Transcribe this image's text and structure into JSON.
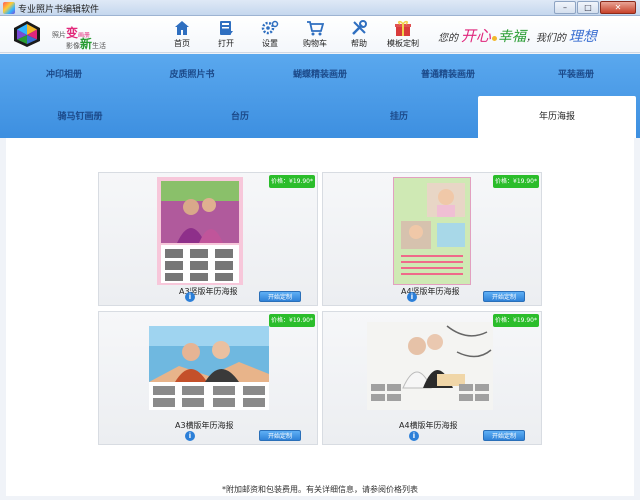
{
  "window": {
    "title": "专业照片书编辑软件"
  },
  "branding": {
    "slogan_left_part1": "照片",
    "slogan_left_big1": "变",
    "slogan_left_small1": "画册",
    "slogan_left_part2": "影像",
    "slogan_left_big2": "新",
    "slogan_left_part3": "生活",
    "slogan_right": [
      "您的",
      "开心",
      "幸福",
      "我们的",
      "理想"
    ]
  },
  "toolbar": [
    {
      "label": "首页",
      "icon": "home-icon"
    },
    {
      "label": "打开",
      "icon": "open-icon"
    },
    {
      "label": "设置",
      "icon": "settings-icon"
    },
    {
      "label": "购物车",
      "icon": "cart-icon"
    },
    {
      "label": "帮助",
      "icon": "help-icon"
    },
    {
      "label": "模板定制",
      "icon": "gift-icon"
    }
  ],
  "tabs": {
    "row1": [
      "冲印相册",
      "皮质照片书",
      "蝴蝶精装画册",
      "普通精装画册",
      "平装画册"
    ],
    "row2": [
      "骑马钉画册",
      "台历",
      "挂历",
      "年历海报"
    ],
    "active": "年历海报"
  },
  "cards": [
    {
      "title": "A3竖版年历海报",
      "price": "价格：¥19.90*",
      "button": "开始定制"
    },
    {
      "title": "A4竖版年历海报",
      "price": "价格：¥19.90*",
      "button": "开始定制"
    },
    {
      "title": "A3横版年历海报",
      "price": "价格：¥19.90*",
      "button": "开始定制"
    },
    {
      "title": "A4横版年历海报",
      "price": "价格：¥19.90*",
      "button": "开始定制"
    }
  ],
  "footer_note": "*附加邮资和包装费用。有关详细信息，请参阅价格列表",
  "colors": {
    "tab_bar": "#4a9be8",
    "price_badge": "#2bbd2b",
    "accent_pink": "#e0267c",
    "accent_green": "#2a9d34"
  }
}
